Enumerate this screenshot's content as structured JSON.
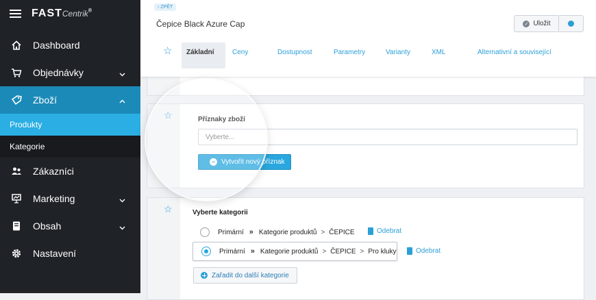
{
  "sidebar": {
    "logo_main": "FAST",
    "logo_sub": "Centrik",
    "logo_reg": "®",
    "items": [
      {
        "label": "Dashboard",
        "icon": "home-icon"
      },
      {
        "label": "Objednávky",
        "icon": "cart-icon"
      },
      {
        "label": "Zboží",
        "icon": "tag-icon"
      },
      {
        "label": "Zákazníci",
        "icon": "users-icon"
      },
      {
        "label": "Marketing",
        "icon": "presentation-icon"
      },
      {
        "label": "Obsah",
        "icon": "book-icon"
      },
      {
        "label": "Nastavení",
        "icon": "gear-icon"
      }
    ],
    "sub_items": [
      {
        "label": "Produkty"
      },
      {
        "label": "Kategorie"
      }
    ]
  },
  "header": {
    "back_label": "‹ ZPĚT",
    "title": "Čepice Black Azure Cap",
    "save_label": "Uložit",
    "tabs": [
      {
        "label": "Základní"
      },
      {
        "label": "Ceny"
      },
      {
        "label": "Dostupnost"
      },
      {
        "label": "Parametry"
      },
      {
        "label": "Varianty"
      },
      {
        "label": "XML"
      },
      {
        "label": "Alternativní a související"
      }
    ]
  },
  "flags": {
    "label": "Příznaky zboží",
    "placeholder": "Vyberte...",
    "create_button": "Vytvořit nový příznak"
  },
  "categories": {
    "label": "Vyberte kategorii",
    "rows": [
      {
        "primary": "Primární",
        "sep": "»",
        "path1": "Kategorie produktů",
        "gt": ">",
        "path2": "ČEPICE",
        "path3": "",
        "remove": "Odebrat",
        "selected": false
      },
      {
        "primary": "Primární",
        "sep": "»",
        "path1": "Kategorie produktů",
        "gt": ">",
        "path2": "ČEPICE",
        "gt2": ">",
        "path3": "Pro kluky",
        "remove": "Odebrat",
        "selected": true
      }
    ],
    "add_button": "Zařadit do další kategorie"
  },
  "colors": {
    "accent": "#2aa7de",
    "sidebar_bg": "#1f2227",
    "active_nav": "#1c8ab8"
  }
}
